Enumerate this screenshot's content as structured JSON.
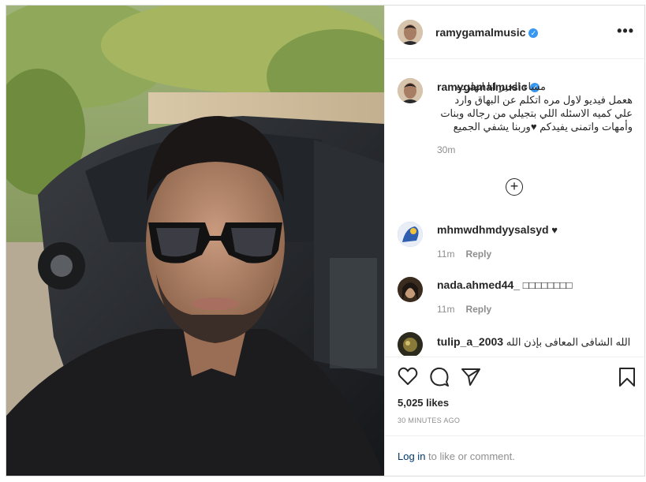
{
  "post": {
    "username": "ramygamalmusic",
    "verified_icon": "verified-badge-icon",
    "more_icon": "more-options-icon",
    "caption": {
      "username": "ramygamalmusic",
      "text": "مساء الخير انا انهارده هعمل فيديو لاول مره اتكلم عن البهاق وارد علي كميه الاسئله اللي بتجيلي من رجاله وبنات وأمهات واتمنى يفيدكم ♥وربنا يشفي الجميع",
      "time": "30m"
    },
    "load_more_icon": "plus-circle-icon",
    "comments": [
      {
        "username": "mhmwdhmdyysalsyd",
        "text": "♥",
        "time": "11m",
        "reply": "Reply"
      },
      {
        "username": "nada.ahmed44_",
        "text": "□□□□□□□□",
        "time": "11m",
        "reply": "Reply"
      },
      {
        "username": "tulip_a_2003",
        "text": "الله الشافى المعافى بإذن الله",
        "time": "",
        "reply": ""
      }
    ],
    "likes": "5,025 likes",
    "timestamp": "30 MINUTES AGO",
    "login": {
      "link": "Log in",
      "rest": " to like or comment."
    },
    "icons": [
      "heart-icon",
      "comment-icon",
      "share-icon",
      "bookmark-icon"
    ],
    "colors": {
      "verified": "#3897f0",
      "link": "#00376b",
      "muted": "#8e8e8e"
    }
  }
}
